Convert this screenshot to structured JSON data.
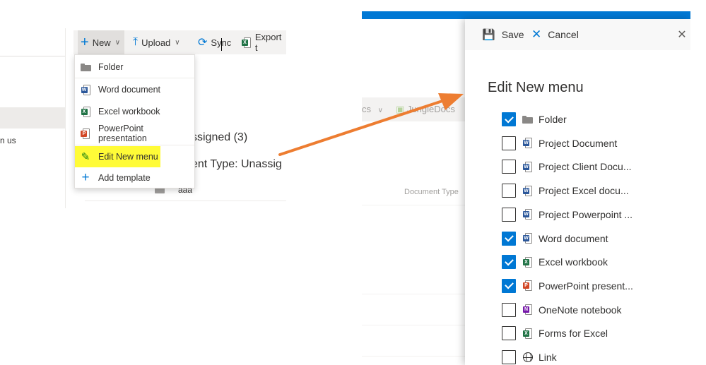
{
  "left": {
    "nav_partial_text": "n us",
    "toolbar": {
      "new_label": "New",
      "upload_label": "Upload",
      "sync_label": "Sync",
      "export_label": "Export t"
    },
    "background": {
      "column_header": "e",
      "group_header": "ssigned (3)",
      "content_type_header": "ent Type: Unassig",
      "item_name": "aaa"
    },
    "new_menu": [
      {
        "label": "Folder",
        "icon": "folder-icon"
      },
      {
        "label": "Word document",
        "icon": "word-icon"
      },
      {
        "label": "Excel workbook",
        "icon": "excel-icon"
      },
      {
        "label": "PowerPoint presentation",
        "icon": "powerpoint-icon"
      },
      {
        "label": "Edit New menu",
        "icon": "pencil-icon",
        "highlighted": true
      },
      {
        "label": "Add template",
        "icon": "plus-icon"
      }
    ]
  },
  "right": {
    "background": {
      "toolbar_partial": "cs",
      "junglemail_label": "JungleDocs",
      "column_header": "Document Type"
    },
    "panel": {
      "save_label": "Save",
      "cancel_label": "Cancel",
      "title": "Edit New menu",
      "options": [
        {
          "label": "Folder",
          "checked": true,
          "icon": "folder-icon"
        },
        {
          "label": "Project Document",
          "checked": false,
          "icon": "word-icon"
        },
        {
          "label": "Project Client Docu...",
          "checked": false,
          "icon": "word-icon"
        },
        {
          "label": "Project Excel docu...",
          "checked": false,
          "icon": "word-icon"
        },
        {
          "label": "Project Powerpoint ...",
          "checked": false,
          "icon": "word-icon"
        },
        {
          "label": "Word document",
          "checked": true,
          "icon": "word-icon"
        },
        {
          "label": "Excel workbook",
          "checked": true,
          "icon": "excel-icon"
        },
        {
          "label": "PowerPoint present...",
          "checked": true,
          "icon": "powerpoint-icon"
        },
        {
          "label": "OneNote notebook",
          "checked": false,
          "icon": "onenote-icon"
        },
        {
          "label": "Forms for Excel",
          "checked": false,
          "icon": "excel-icon"
        },
        {
          "label": "Link",
          "checked": false,
          "icon": "globe-icon"
        }
      ]
    }
  },
  "colors": {
    "accent": "#0078d4",
    "arrow": "#ed7d31",
    "highlight": "#fffb37",
    "word": "#2b579a",
    "excel": "#217346",
    "powerpoint": "#d24726",
    "onenote": "#7719aa"
  }
}
